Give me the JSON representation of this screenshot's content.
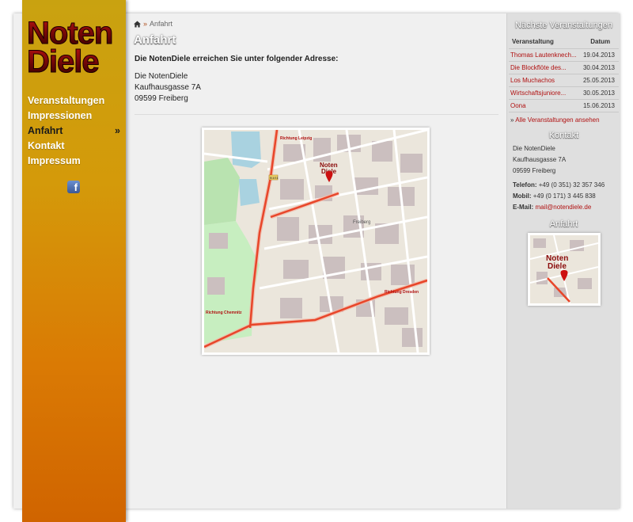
{
  "logo": {
    "line1": "Noten",
    "line2": "Diele"
  },
  "nav": {
    "items": [
      {
        "label": "Veranstaltungen"
      },
      {
        "label": "Impressionen"
      },
      {
        "label": "Anfahrt",
        "marker": "»"
      },
      {
        "label": "Kontakt"
      },
      {
        "label": "Impressum"
      }
    ]
  },
  "social": {
    "facebook_glyph": "f"
  },
  "breadcrumb": {
    "separator": "»",
    "current": "Anfahrt"
  },
  "main": {
    "title": "Anfahrt",
    "intro": "Die NotenDiele erreichen Sie unter folgender Adresse:",
    "address": [
      "Die NotenDiele",
      "Kaufhausgasse 7A",
      "09599 Freiberg"
    ]
  },
  "map": {
    "labels": {
      "top": "Richtung Leipzig",
      "bottom_left": "Richtung Chemnitz",
      "right": "Richtung Dresden",
      "district": "Freiberg",
      "pin_line1": "Noten",
      "pin_line2": "Diele",
      "road": "B101"
    }
  },
  "sidebar": {
    "events_title": "Nächste Veranstaltungen",
    "events_headers": {
      "name": "Veranstaltung",
      "date": "Datum"
    },
    "events": [
      {
        "name": "Thomas Lautenknech...",
        "date": "19.04.2013"
      },
      {
        "name": "Die Blockflöte des...",
        "date": "30.04.2013"
      },
      {
        "name": "Los Muchachos",
        "date": "25.05.2013"
      },
      {
        "name": "Wirtschaftsjuniore...",
        "date": "30.05.2013"
      },
      {
        "name": "Oona",
        "date": "15.06.2013"
      }
    ],
    "all_events_marker": "»",
    "all_events_label": "Alle Veranstaltungen ansehen",
    "contact_title": "Kontakt",
    "contact_address": [
      "Die NotenDiele",
      "Kaufhausgasse 7A",
      "09599 Freiberg"
    ],
    "phone_label": "Telefon:",
    "phone": "+49 (0 351) 32 357 346",
    "mobile_label": "Mobil:",
    "mobile": "+49 (0 171) 3 445 838",
    "email_label": "E-Mail:",
    "email": "mail@notendiele.de",
    "directions_title": "Anfahrt"
  },
  "colors": {
    "accent": "#b01010",
    "sidebar_gold": "#d49a0a",
    "sidebar_orange": "#d06400",
    "road": "#e8462a"
  }
}
